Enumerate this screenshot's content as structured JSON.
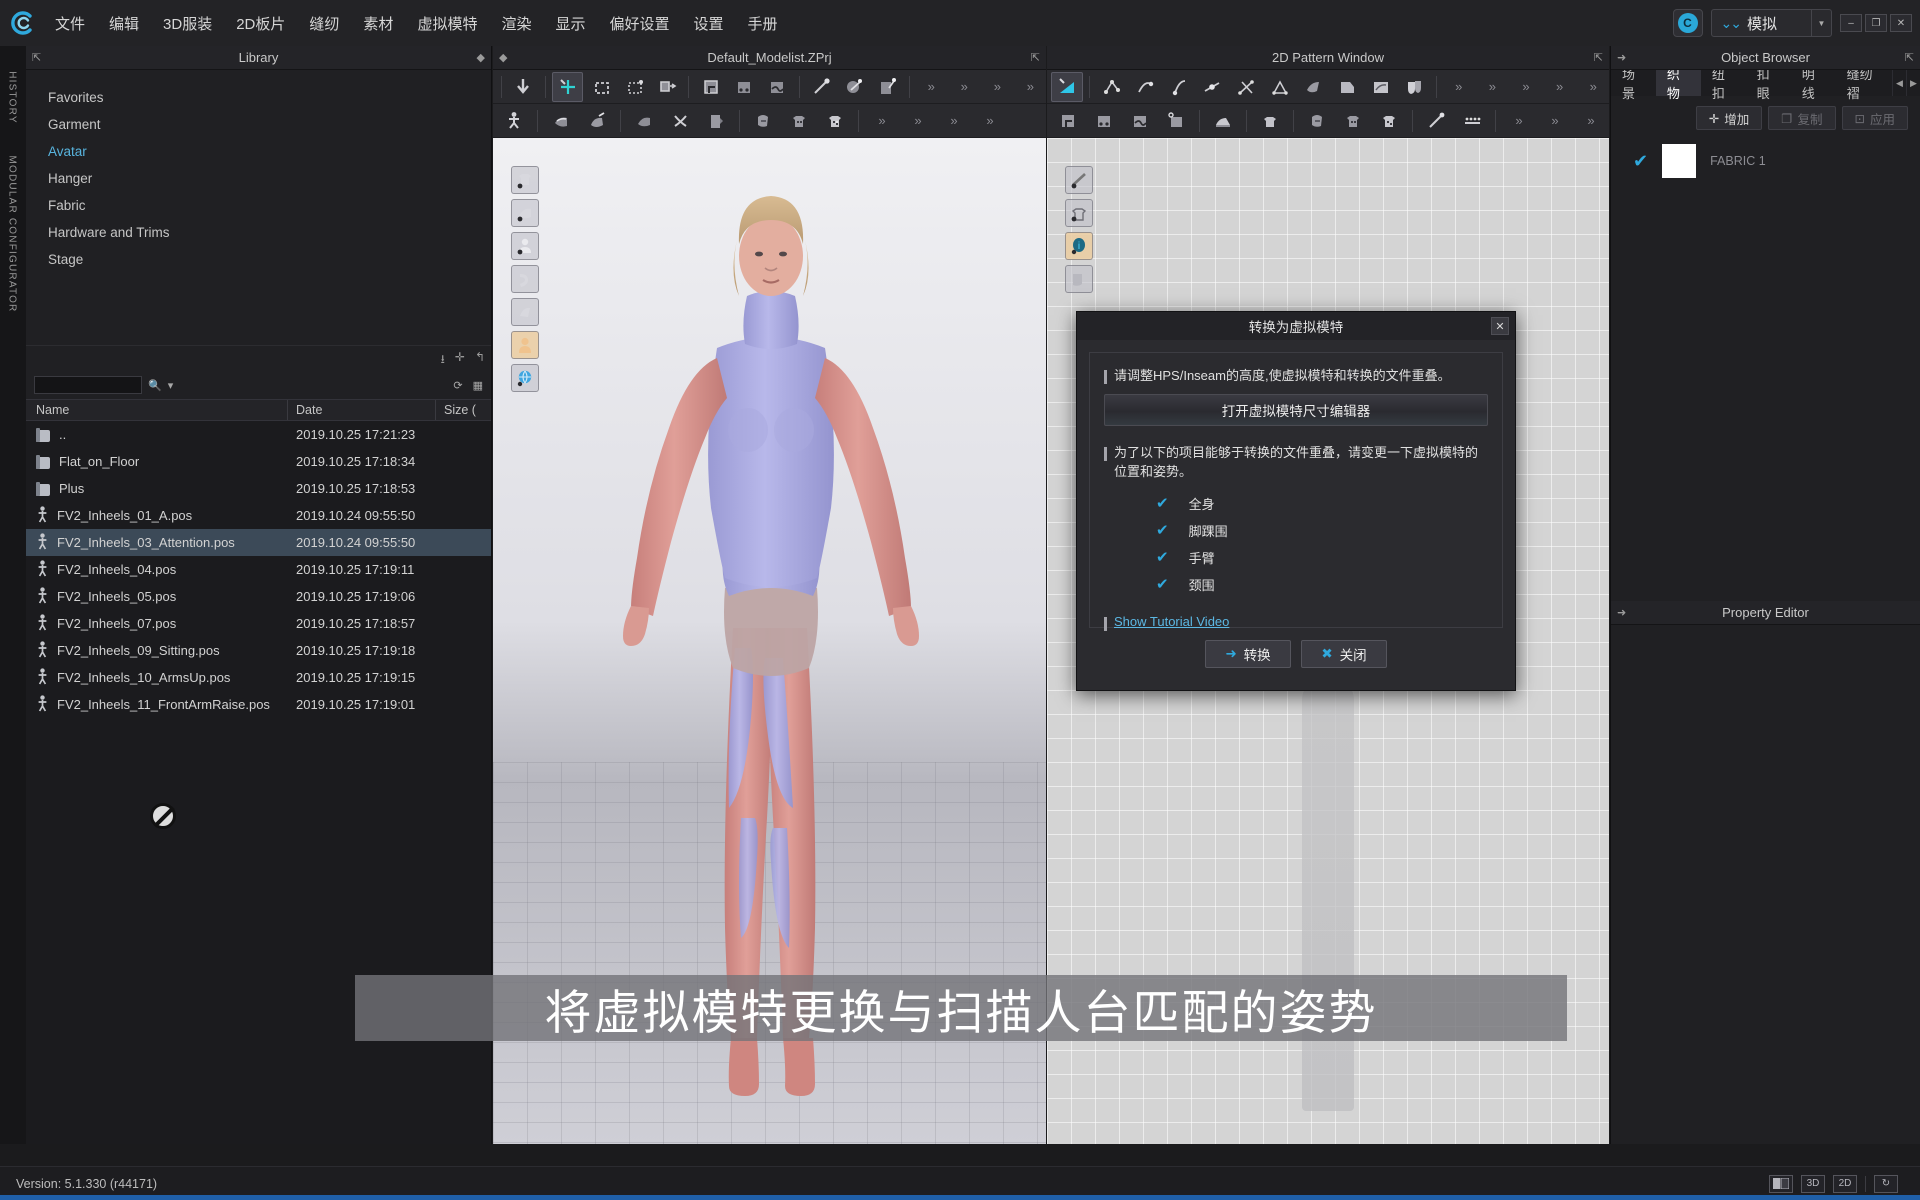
{
  "app": {
    "logo_icon": "clo-logo-icon",
    "version": "Version: 5.1.330 (r44171)"
  },
  "menubar": {
    "items": [
      {
        "label": "文件"
      },
      {
        "label": "编辑"
      },
      {
        "label": "3D服装"
      },
      {
        "label": "2D板片"
      },
      {
        "label": "缝纫"
      },
      {
        "label": "素材"
      },
      {
        "label": "虚拟模特"
      },
      {
        "label": "渲染"
      },
      {
        "label": "显示"
      },
      {
        "label": "偏好设置"
      },
      {
        "label": "设置"
      },
      {
        "label": "手册"
      }
    ],
    "cloud_icon": "cloud-icon",
    "mode_label": "模拟",
    "mode_chevron_icon": "chevron-double-down-icon",
    "mode_dropdown_icon": "chevron-down-icon",
    "window_buttons": [
      {
        "label": "–",
        "name": "minimize-button"
      },
      {
        "label": "❐",
        "name": "maximize-button"
      },
      {
        "label": "✕",
        "name": "close-button"
      }
    ]
  },
  "rail": {
    "history": "HISTORY",
    "modular": "MODULAR CONFIGURATOR"
  },
  "library": {
    "title": "Library",
    "expand_icon": "expand-icon",
    "pin_icon": "pin-icon",
    "categories": [
      {
        "label": "Favorites",
        "active": false
      },
      {
        "label": "Garment",
        "active": false
      },
      {
        "label": "Avatar",
        "active": true
      },
      {
        "label": "Hanger",
        "active": false
      },
      {
        "label": "Fabric",
        "active": false
      },
      {
        "label": "Hardware and Trims",
        "active": false
      },
      {
        "label": "Stage",
        "active": false
      }
    ],
    "toolbar_icons": [
      "download-icon",
      "add-icon",
      "refresh-icon"
    ],
    "search": {
      "value": "",
      "placeholder": "",
      "icon": "search-icon",
      "dropdown_icon": "chevron-down-icon"
    },
    "list_view_icons": [
      "refresh-list-icon",
      "grid-view-icon"
    ],
    "columns": [
      "Name",
      "Date",
      "Size ("
    ],
    "rows": [
      {
        "name": "..",
        "date": "2019.10.25 17:21:23",
        "icon": "folder-icon",
        "selected": false
      },
      {
        "name": "Flat_on_Floor",
        "date": "2019.10.25 17:18:34",
        "icon": "folder-icon",
        "selected": false
      },
      {
        "name": "Plus",
        "date": "2019.10.25 17:18:53",
        "icon": "folder-icon",
        "selected": false
      },
      {
        "name": "FV2_Inheels_01_A.pos",
        "date": "2019.10.24 09:55:50",
        "icon": "pose-icon",
        "selected": false
      },
      {
        "name": "FV2_Inheels_03_Attention.pos",
        "date": "2019.10.24 09:55:50",
        "icon": "pose-icon",
        "selected": true
      },
      {
        "name": "FV2_Inheels_04.pos",
        "date": "2019.10.25 17:19:11",
        "icon": "pose-icon",
        "selected": false
      },
      {
        "name": "FV2_Inheels_05.pos",
        "date": "2019.10.25 17:19:06",
        "icon": "pose-icon",
        "selected": false
      },
      {
        "name": "FV2_Inheels_07.pos",
        "date": "2019.10.25 17:18:57",
        "icon": "pose-icon",
        "selected": false
      },
      {
        "name": "FV2_Inheels_09_Sitting.pos",
        "date": "2019.10.25 17:19:18",
        "icon": "pose-icon",
        "selected": false
      },
      {
        "name": "FV2_Inheels_10_ArmsUp.pos",
        "date": "2019.10.25 17:19:15",
        "icon": "pose-icon",
        "selected": false
      },
      {
        "name": "FV2_Inheels_11_FrontArmRaise.pos",
        "date": "2019.10.25 17:19:01",
        "icon": "pose-icon",
        "selected": false
      }
    ],
    "cursor_icon": "no-drop-cursor-icon"
  },
  "viewport3d": {
    "title": "Default_Modelist.ZPrj",
    "expand_icon": "expand-icon",
    "pin_icon": "pin-icon",
    "side_tools": [
      {
        "icon": "show-garment-icon",
        "active": false
      },
      {
        "icon": "show-pattern-3d-icon",
        "active": false
      },
      {
        "icon": "show-avatar-icon",
        "active": false
      },
      {
        "icon": "show-stage-icon",
        "active": false
      },
      {
        "icon": "show-shadow-icon",
        "active": false
      },
      {
        "icon": "avatar-skin-icon",
        "active": true
      },
      {
        "icon": "show-environment-icon",
        "active": false
      }
    ]
  },
  "viewport2d": {
    "title": "2D Pattern Window",
    "expand_icon": "expand-icon",
    "side_tools": [
      {
        "icon": "show-baseline-icon",
        "active": false
      },
      {
        "icon": "show-pattern-outline-icon",
        "active": false
      },
      {
        "icon": "show-info-icon",
        "active": true
      },
      {
        "icon": "show-texture-icon",
        "active": false
      }
    ]
  },
  "object_browser": {
    "title": "Object Browser",
    "expand_icon": "expand-icon",
    "pin_icon": "pin-icon",
    "tabs": [
      {
        "label": "场景",
        "active": false
      },
      {
        "label": "织物",
        "active": true
      },
      {
        "label": "纽扣",
        "active": false
      },
      {
        "label": "扣眼",
        "active": false
      },
      {
        "label": "明线",
        "active": false
      },
      {
        "label": "缝纫褶",
        "active": false
      }
    ],
    "tab_arrows": [
      "◀",
      "▶"
    ],
    "actions": [
      {
        "label": "增加",
        "icon": "plus-icon",
        "enabled": true
      },
      {
        "label": "复制",
        "icon": "copy-icon",
        "enabled": false
      },
      {
        "label": "应用",
        "icon": "apply-icon",
        "enabled": false
      }
    ],
    "items": [
      {
        "name": "FABRIC 1",
        "checked": true,
        "swatch": "#ffffff",
        "check_icon": "check-icon"
      }
    ]
  },
  "property_editor": {
    "title": "Property Editor",
    "expand_icon": "expand-icon"
  },
  "dialog": {
    "title": "转换为虚拟模特",
    "close_icon": "close-icon",
    "instruction1": "请调整HPS/Inseam的高度,使虚拟模特和转换的文件重叠。",
    "open_editor_button": "打开虚拟模特尺寸编辑器",
    "instruction2": "为了以下的项目能够于转换的文件重叠，请变更一下虚拟模特的位置和姿势。",
    "checklist": [
      {
        "label": "全身",
        "checked": true
      },
      {
        "label": "脚踝围",
        "checked": true
      },
      {
        "label": "手臂",
        "checked": true
      },
      {
        "label": "颈围",
        "checked": true
      }
    ],
    "tutorial_link": "Show Tutorial Video",
    "confirm_button": "转换",
    "confirm_icon": "arrow-right-icon",
    "cancel_button": "关闭",
    "cancel_icon": "x-icon"
  },
  "subtitle": {
    "text": "将虚拟模特更换与扫描人台匹配的姿势"
  },
  "statusbar": {
    "buttons": [
      {
        "label": "",
        "name": "split-view-button",
        "icon": "split-view-icon"
      },
      {
        "label": "3D",
        "name": "view-3d-button",
        "icon": "3d-icon"
      },
      {
        "label": "2D",
        "name": "view-2d-button",
        "icon": "2d-icon"
      },
      {
        "label": "↻",
        "name": "reset-view-button",
        "icon": "refresh-icon"
      }
    ]
  },
  "colors": {
    "accent": "#2fa9dd",
    "selection": "#3c4a58",
    "panel": "#202023",
    "link": "#5cb8e4"
  }
}
